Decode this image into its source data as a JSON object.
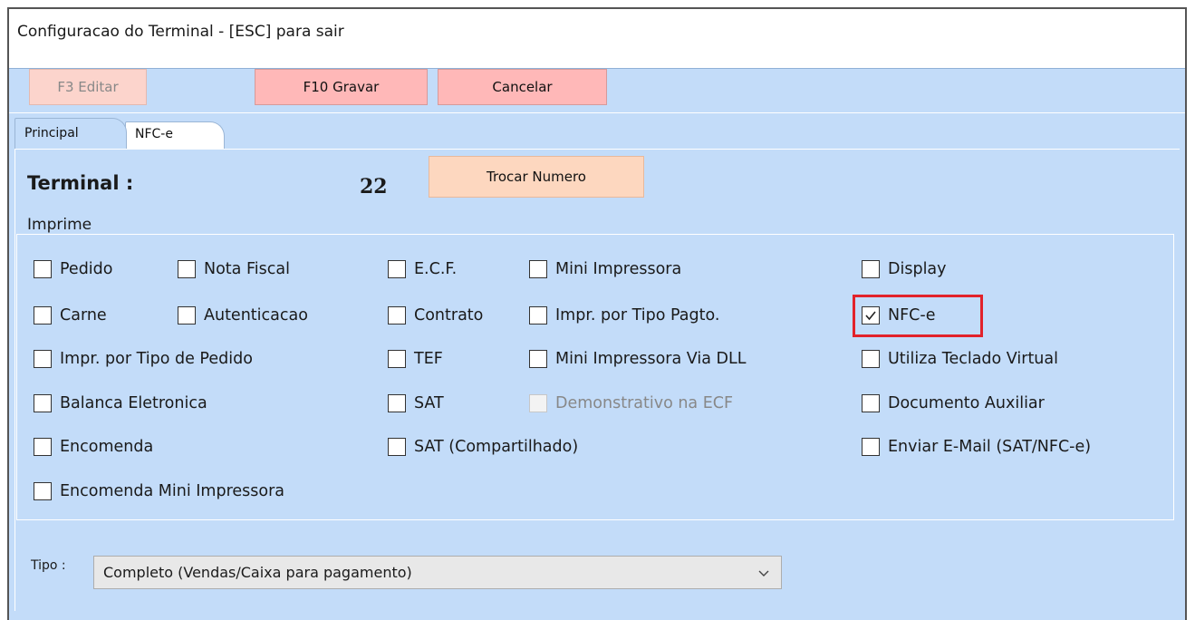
{
  "window": {
    "title": "Configuracao do Terminal - [ESC] para sair"
  },
  "toolbar": {
    "edit_label": "F3 Editar",
    "save_label": "F10 Gravar",
    "cancel_label": "Cancelar"
  },
  "tabs": [
    {
      "label": "Principal",
      "active": true
    },
    {
      "label": "NFC-e",
      "active": false
    }
  ],
  "terminal": {
    "label": "Terminal :",
    "number": "22",
    "change_button": "Trocar Numero"
  },
  "imprime": {
    "label": "Imprime",
    "options": [
      {
        "label": "Pedido",
        "checked": false
      },
      {
        "label": "Nota Fiscal",
        "checked": false
      },
      {
        "label": "E.C.F.",
        "checked": false
      },
      {
        "label": "Mini Impressora",
        "checked": false
      },
      {
        "label": "Display",
        "checked": false
      },
      {
        "label": "Carne",
        "checked": false
      },
      {
        "label": "Autenticacao",
        "checked": false
      },
      {
        "label": "Contrato",
        "checked": false
      },
      {
        "label": "Impr. por Tipo Pagto.",
        "checked": false
      },
      {
        "label": "NFC-e",
        "checked": true
      },
      {
        "label": "Impr. por Tipo de Pedido",
        "checked": false
      },
      {
        "label": "TEF",
        "checked": false
      },
      {
        "label": "Mini Impressora Via DLL",
        "checked": false
      },
      {
        "label": "Utiliza Teclado Virtual",
        "checked": false
      },
      {
        "label": "Balanca Eletronica",
        "checked": false
      },
      {
        "label": "SAT",
        "checked": false
      },
      {
        "label": "Demonstrativo na ECF",
        "checked": false,
        "disabled": true
      },
      {
        "label": "Documento Auxiliar",
        "checked": false
      },
      {
        "label": "Encomenda",
        "checked": false
      },
      {
        "label": "SAT (Compartilhado)",
        "checked": false
      },
      {
        "label": "Enviar E-Mail (SAT/NFC-e)",
        "checked": false
      },
      {
        "label": "Encomenda Mini Impressora",
        "checked": false
      }
    ]
  },
  "tipo": {
    "label": "Tipo :",
    "selected": "Completo (Vendas/Caixa para pagamento)"
  },
  "colors": {
    "panel_bg": "#c3dcf9",
    "button_bg": "#ffb8b8",
    "highlight": "#e2222a"
  }
}
